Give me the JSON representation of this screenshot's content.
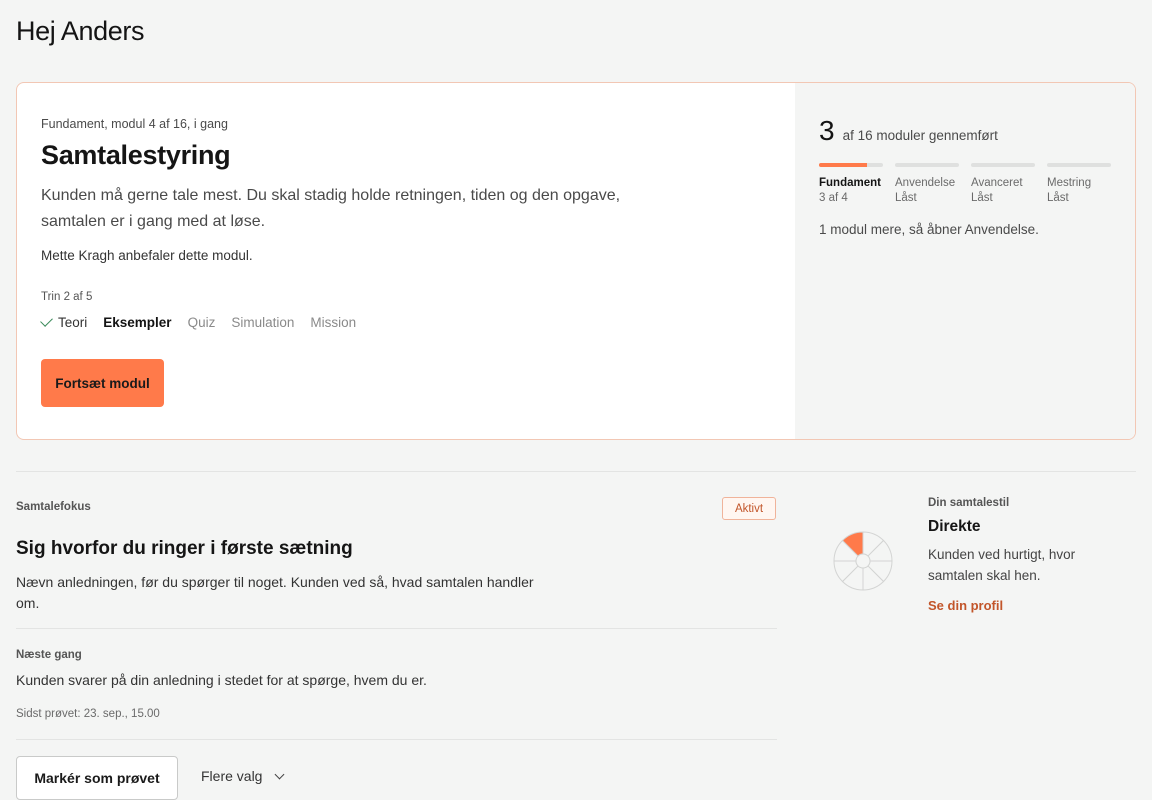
{
  "greeting": "Hej Anders",
  "module": {
    "meta": "Fundament, modul 4 af 16, i gang",
    "title": "Samtalestyring",
    "description": "Kunden må gerne tale mest. Du skal stadig holde retningen, tiden og den opgave, samtalen er i gang med at løse.",
    "recommendation": "Mette Kragh anbefaler dette modul.",
    "step_count": "Trin 2 af 5",
    "steps": [
      {
        "label": "Teori",
        "state": "done",
        "icon": "check-icon"
      },
      {
        "label": "Eksempler",
        "state": "current"
      },
      {
        "label": "Quiz",
        "state": "upcoming"
      },
      {
        "label": "Simulation",
        "state": "upcoming"
      },
      {
        "label": "Mission",
        "state": "upcoming"
      }
    ],
    "continue_label": "Fortsæt modul"
  },
  "progress": {
    "completed": "3",
    "completed_text": "af 16 moduler gennemført",
    "tracks": [
      {
        "name": "Fundament",
        "sub": "3 af 4",
        "fill": 0.75
      },
      {
        "name": "Anvendelse",
        "sub": "Låst",
        "fill": 0
      },
      {
        "name": "Avanceret",
        "sub": "Låst",
        "fill": 0
      },
      {
        "name": "Mestring",
        "sub": "Låst",
        "fill": 0
      }
    ],
    "unlock_note": "1 modul mere, så åbner Anvendelse."
  },
  "focus": {
    "label": "Samtalefokus",
    "badge": "Aktivt",
    "title": "Sig hvorfor du ringer i første sætning",
    "description": "Nævn anledningen, før du spørger til noget. Kunden ved så, hvad samtalen handler om.",
    "next_label": "Næste gang",
    "next_text": "Kunden svarer på din anledning i stedet for at spørge, hvem du er.",
    "last_tried": "Sidst prøvet: 23. sep., 15.00",
    "mark_tried_label": "Markér som prøvet",
    "more_options_label": "Flere valg"
  },
  "style": {
    "label": "Din samtalestil",
    "name": "Direkte",
    "description": "Kunden ved hurtigt, hvor samtalen skal hen.",
    "profile_link": "Se din profil",
    "accent": "#ff7a4a",
    "segments": 8,
    "highlighted_segment": 7
  },
  "colors": {
    "accent": "#ff7a4a",
    "link": "#c2552a",
    "background": "#f4f5f4"
  }
}
